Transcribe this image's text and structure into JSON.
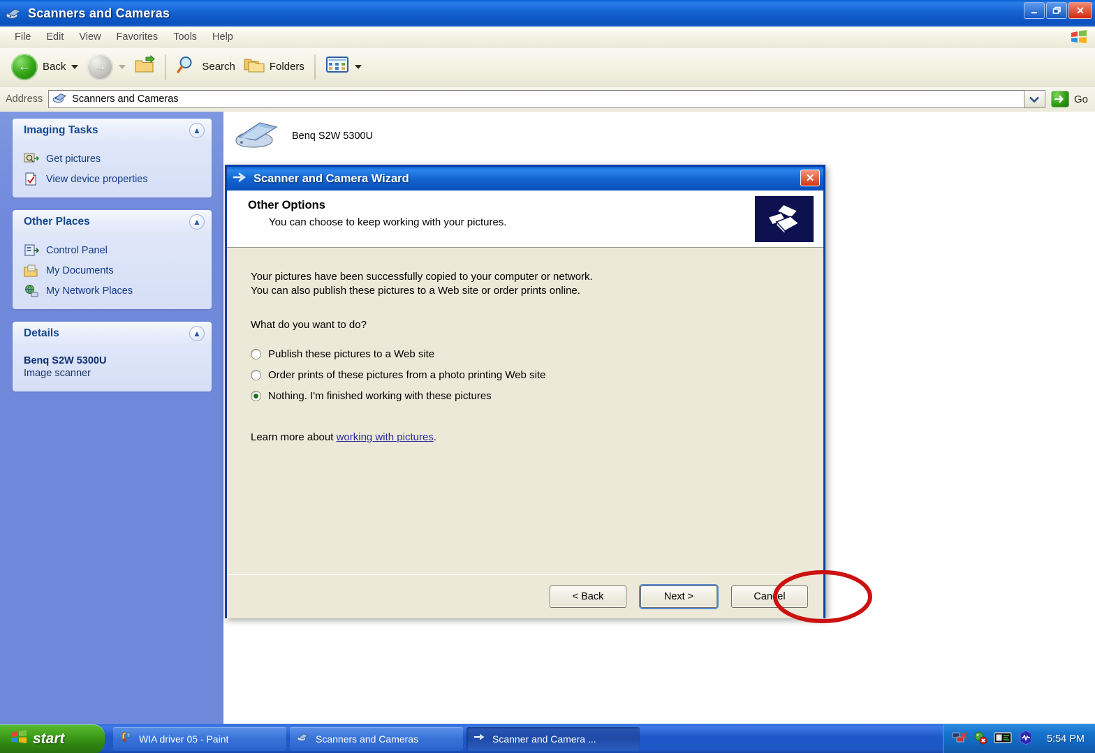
{
  "window": {
    "title": "Scanners and Cameras",
    "icon": "scanner-camera-icon",
    "controls": {
      "minimize": "_",
      "restore": "❐",
      "close": "✕"
    }
  },
  "menubar": {
    "items": [
      "File",
      "Edit",
      "View",
      "Favorites",
      "Tools",
      "Help"
    ],
    "logo": "windows-flag-logo"
  },
  "toolbar": {
    "back_label": "Back",
    "search_label": "Search",
    "folders_label": "Folders",
    "icons": {
      "back": "back-arrow-icon",
      "forward": "forward-arrow-icon",
      "up": "up-folder-icon",
      "search": "magnifier-icon",
      "folders": "folder-icon",
      "views": "views-grid-icon"
    }
  },
  "address": {
    "label": "Address",
    "value": "Scanners and Cameras",
    "go_label": "Go",
    "dropdown_icon": "chevron-down-icon",
    "go_icon": "green-arrow-icon"
  },
  "sidebar": {
    "panels": [
      {
        "title": "Imaging Tasks",
        "collapse_icon": "chevron-up-icon",
        "links": [
          {
            "label": "Get pictures",
            "icon": "get-pictures-icon"
          },
          {
            "label": "View device properties",
            "icon": "device-properties-icon"
          }
        ]
      },
      {
        "title": "Other Places",
        "collapse_icon": "chevron-up-icon",
        "links": [
          {
            "label": "Control Panel",
            "icon": "control-panel-icon"
          },
          {
            "label": "My Documents",
            "icon": "my-documents-icon"
          },
          {
            "label": "My Network Places",
            "icon": "network-places-icon"
          }
        ]
      },
      {
        "title": "Details",
        "collapse_icon": "chevron-up-icon",
        "detail_name": "Benq S2W 5300U",
        "detail_type": "Image scanner"
      }
    ]
  },
  "content": {
    "device_label": "Benq S2W 5300U",
    "device_icon": "scanner-device-icon"
  },
  "wizard": {
    "title": "Scanner and Camera Wizard",
    "title_icon": "wizard-arrow-icon",
    "close_label": "✕",
    "heading": "Other Options",
    "subheading": "You can choose to keep working with your pictures.",
    "header_icon": "scanner-camera-banner-icon",
    "paragraph_line1": "Your pictures have been successfully copied to your computer or network.",
    "paragraph_line2": "You can also publish these pictures to a Web site or order prints online.",
    "question": "What do you want to do?",
    "options": [
      {
        "label": "Publish these pictures to a Web site",
        "selected": false
      },
      {
        "label": "Order prints of these pictures from a photo printing Web site",
        "selected": false
      },
      {
        "label": "Nothing. I'm finished working with these pictures",
        "selected": true
      }
    ],
    "learn_prefix": "Learn more about ",
    "learn_link": "working with pictures",
    "learn_suffix": ".",
    "buttons": {
      "back": "< Back",
      "next": "Next >",
      "cancel": "Cancel"
    },
    "annotation": {
      "shape": "ellipse",
      "color": "#cc1111",
      "target": "Next >"
    }
  },
  "taskbar": {
    "start_label": "start",
    "start_icon": "windows-logo-icon",
    "tasks": [
      {
        "label": "WIA driver 05 - Paint",
        "icon": "paint-icon",
        "active": false
      },
      {
        "label": "Scanners and Cameras",
        "icon": "scanner-camera-icon",
        "active": false
      },
      {
        "label": "Scanner and Camera ...",
        "icon": "wizard-arrow-icon",
        "active": true
      }
    ],
    "tray_icons": [
      "network-disconnected-icon",
      "antivirus-alert-icon",
      "display-settings-icon",
      "audio-wave-icon"
    ],
    "clock": "5:54 PM"
  }
}
